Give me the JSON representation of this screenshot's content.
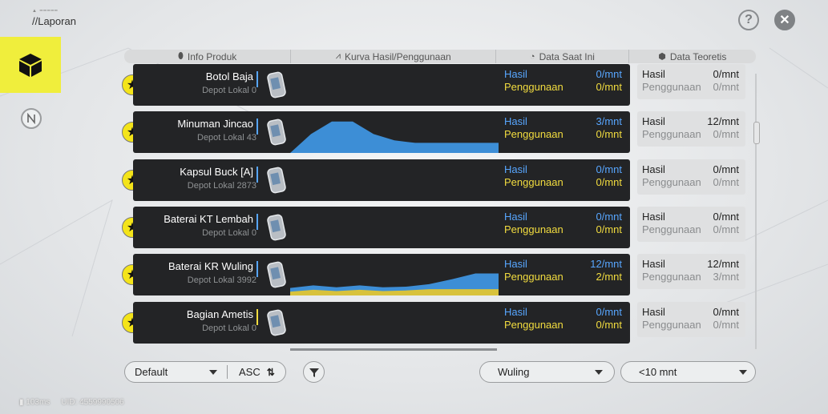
{
  "header_block": {
    "title": "//Laporan"
  },
  "columns": [
    {
      "label": "Info Produk",
      "icon": "tag-icon"
    },
    {
      "label": "Kurva Hasil/Penggunaan",
      "icon": "line-chart-icon"
    },
    {
      "label": "Data Saat Ini",
      "icon": "pie-icon"
    },
    {
      "label": "Data Teoretis",
      "icon": "box-icon"
    }
  ],
  "labels": {
    "hasil": "Hasil",
    "penggunaan": "Penggunaan"
  },
  "rows": [
    {
      "name": "Botol Baja",
      "depot": "Depot Lokal 0",
      "bar_color": "#57a6ff",
      "cur_hasil": "0/mnt",
      "cur_peng": "0/mnt",
      "theo_hasil": "0/mnt",
      "theo_peng": "0/mnt"
    },
    {
      "name": "Minuman Jincao",
      "depot": "Depot Lokal 43",
      "bar_color": "#57a6ff",
      "cur_hasil": "3/mnt",
      "cur_peng": "0/mnt",
      "theo_hasil": "12/mnt",
      "theo_peng": "0/mnt"
    },
    {
      "name": "Kapsul Buck [A]",
      "depot": "Depot Lokal 2873",
      "bar_color": "#57a6ff",
      "cur_hasil": "0/mnt",
      "cur_peng": "0/mnt",
      "theo_hasil": "0/mnt",
      "theo_peng": "0/mnt"
    },
    {
      "name": "Baterai KT Lembah",
      "depot": "Depot Lokal 0",
      "bar_color": "#57a6ff",
      "cur_hasil": "0/mnt",
      "cur_peng": "0/mnt",
      "theo_hasil": "0/mnt",
      "theo_peng": "0/mnt"
    },
    {
      "name": "Baterai KR Wuling",
      "depot": "Depot Lokal 3992",
      "bar_color": "#57a6ff",
      "cur_hasil": "12/mnt",
      "cur_peng": "2/mnt",
      "theo_hasil": "12/mnt",
      "theo_peng": "3/mnt"
    },
    {
      "name": "Bagian Ametis",
      "depot": "Depot Lokal 0",
      "bar_color": "#f2dc3f",
      "cur_hasil": "0/mnt",
      "cur_peng": "0/mnt",
      "theo_hasil": "0/mnt",
      "theo_peng": "0/mnt"
    }
  ],
  "curves": {
    "Minuman Jincao": {
      "hasil": [
        0,
        3,
        5,
        5,
        3,
        2,
        1.6,
        1.6,
        1.6,
        1.6,
        1.6
      ],
      "penggunaan": []
    },
    "Baterai KR Wuling": {
      "hasil": [
        1.2,
        1.6,
        1.3,
        1.6,
        1.3,
        1.4,
        1.8,
        2.6,
        3.5,
        3.5
      ],
      "penggunaan": [
        0.6,
        0.9,
        0.7,
        0.9,
        0.7,
        0.8,
        1.0,
        1.0,
        1.0,
        1.0
      ]
    }
  },
  "controls": {
    "sort": "Default",
    "order": "ASC",
    "region": "Wuling",
    "time": "<10 mnt"
  },
  "status": {
    "ping": "103ms",
    "uid": "UID: 4559990506"
  },
  "colors": {
    "accent_yellow": "#f0ee3c",
    "hasil_blue": "#57a6ff",
    "penggunaan_yellow": "#f2dc3f",
    "card_dark": "#232426"
  }
}
